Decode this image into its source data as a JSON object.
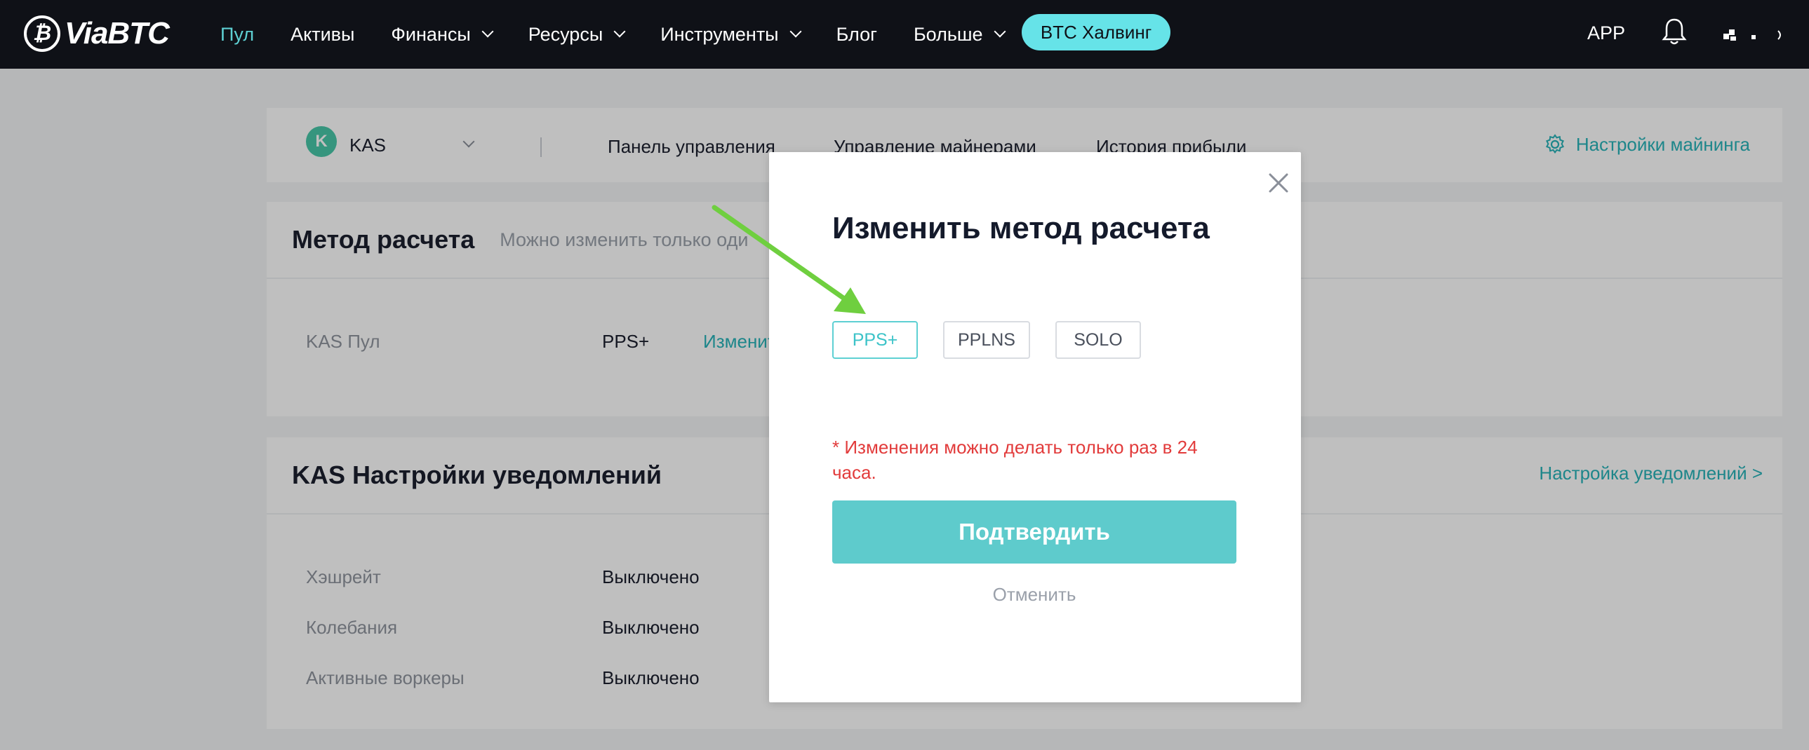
{
  "nav": {
    "logo_text": "ViaBTC",
    "items": [
      {
        "label": "Пул",
        "active": true,
        "dropdown": false
      },
      {
        "label": "Активы",
        "active": false,
        "dropdown": false
      },
      {
        "label": "Финансы",
        "active": false,
        "dropdown": true
      },
      {
        "label": "Ресурсы",
        "active": false,
        "dropdown": true
      },
      {
        "label": "Инструменты",
        "active": false,
        "dropdown": true
      },
      {
        "label": "Блог",
        "active": false,
        "dropdown": false
      },
      {
        "label": "Больше",
        "active": false,
        "dropdown": true
      }
    ],
    "halving_button": "BTC Халвинг",
    "app_label": "APP"
  },
  "coin_bar": {
    "coin": "KAS",
    "tabs": [
      "Панель управления",
      "Управление майнерами",
      "История прибыли"
    ],
    "settings_label": "Настройки майнинга"
  },
  "payment_section": {
    "title": "Метод расчета",
    "subtitle": "Можно изменить только оди",
    "pool_label": "KAS Пул",
    "pool_value": "PPS+",
    "change_link": "Изменит"
  },
  "notify_section": {
    "title": "KAS Настройки уведомлений",
    "settings_link": "Настройка уведомлений >",
    "rows": [
      {
        "label": "Хэшрейт",
        "value": "Выключено"
      },
      {
        "label": "Колебания",
        "value": "Выключено"
      },
      {
        "label": "Активные воркеры",
        "value": "Выключено"
      }
    ]
  },
  "modal": {
    "title": "Изменить метод расчета",
    "options": [
      "PPS+",
      "PPLNS",
      "SOLO"
    ],
    "selected": "PPS+",
    "notice": "* Изменения можно делать только раз в 24 часа.",
    "confirm_label": "Подтвердить",
    "cancel_label": "Отменить"
  },
  "colors": {
    "accent": "#5ed0d3",
    "confirm_bg": "#5ecbcc",
    "notice_red": "#e23b3b",
    "nav_bg": "#0f1117",
    "annotation_arrow": "#6fcf3f"
  }
}
